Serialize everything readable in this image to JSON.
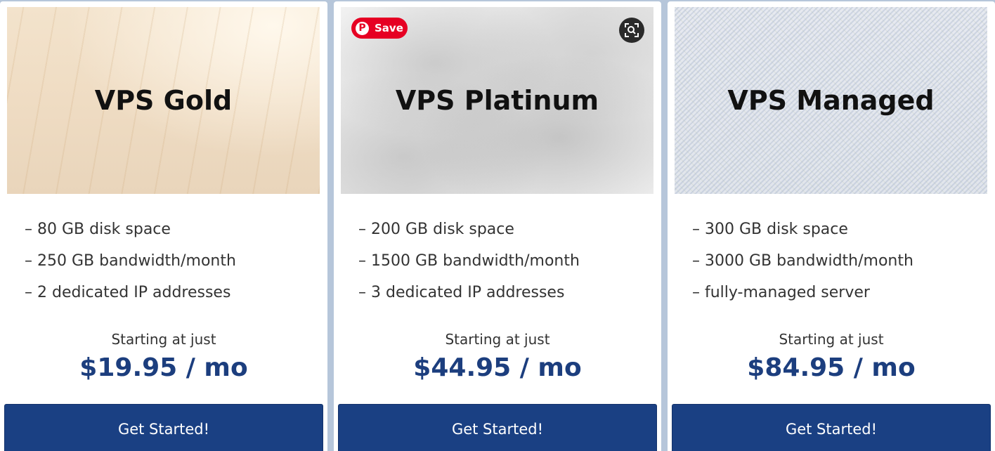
{
  "plans": [
    {
      "name": "VPS Gold",
      "features": [
        "– 80 GB disk space",
        "– 250 GB bandwidth/month",
        "– 2 dedicated IP addresses"
      ],
      "starting_label": "Starting at just",
      "price": "$19.95 / mo",
      "cta": "Get Started!"
    },
    {
      "name": "VPS Platinum",
      "features": [
        "– 200 GB disk space",
        "– 1500 GB bandwidth/month",
        "– 3 dedicated IP addresses"
      ],
      "starting_label": "Starting at just",
      "price": "$44.95 / mo",
      "cta": "Get Started!"
    },
    {
      "name": "VPS Managed",
      "features": [
        "– 300 GB disk space",
        "– 3000 GB bandwidth/month",
        "– fully-managed server"
      ],
      "starting_label": "Starting at just",
      "price": "$84.95 / mo",
      "cta": "Get Started!"
    }
  ],
  "overlay": {
    "save_label": "Save",
    "save_icon": "pinterest-icon",
    "lens_icon": "visual-search-icon"
  },
  "colors": {
    "accent": "#1a4083",
    "price": "#1c3e7e",
    "save_red": "#e60023",
    "background": "#b6c6da"
  }
}
